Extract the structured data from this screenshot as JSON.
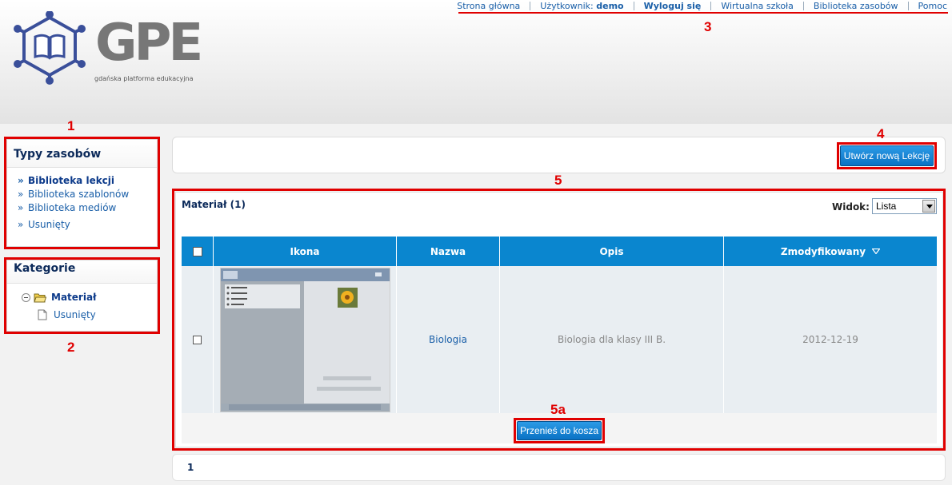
{
  "topnav": {
    "home": "Strona główna",
    "user_label": "Użytkownik:",
    "user_name": "demo",
    "logout": "Wyloguj się",
    "virtual_school": "Wirtualna szkoła",
    "resource_library": "Biblioteka zasobów",
    "help": "Pomoc"
  },
  "logo": {
    "text": "GPE",
    "subtitle": "gdańska platforma edukacyjna"
  },
  "annotations": [
    "1",
    "2",
    "3",
    "4",
    "5",
    "5a"
  ],
  "sidebar": {
    "types_title": "Typy zasobów",
    "types_items": [
      {
        "label": "Biblioteka lekcji"
      },
      {
        "label": "Biblioteka szablonów"
      },
      {
        "label": "Biblioteka mediów"
      },
      {
        "label": "Usunięty"
      }
    ],
    "categories_title": "Kategorie",
    "categories_tree": [
      {
        "label": "Materiał"
      },
      {
        "label": "Usunięty"
      }
    ]
  },
  "toolbar": {
    "create_lesson": "Utwórz nową Lekcję"
  },
  "main": {
    "section_title": "Materiał (1)",
    "view_label": "Widok:",
    "view_value": "Lista",
    "columns": [
      "Ikona",
      "Nazwa",
      "Opis",
      "Zmodyfikowany"
    ],
    "rows": [
      {
        "name": "Biologia",
        "description": "Biologia dla klasy III B.",
        "modified": "2012-12-19"
      }
    ],
    "trash_button": "Przenieś do kosza"
  },
  "pager": {
    "current": "1"
  },
  "colors": {
    "accent": "#0a86cf",
    "annotation": "#e00000",
    "link": "#1a5fa8"
  }
}
